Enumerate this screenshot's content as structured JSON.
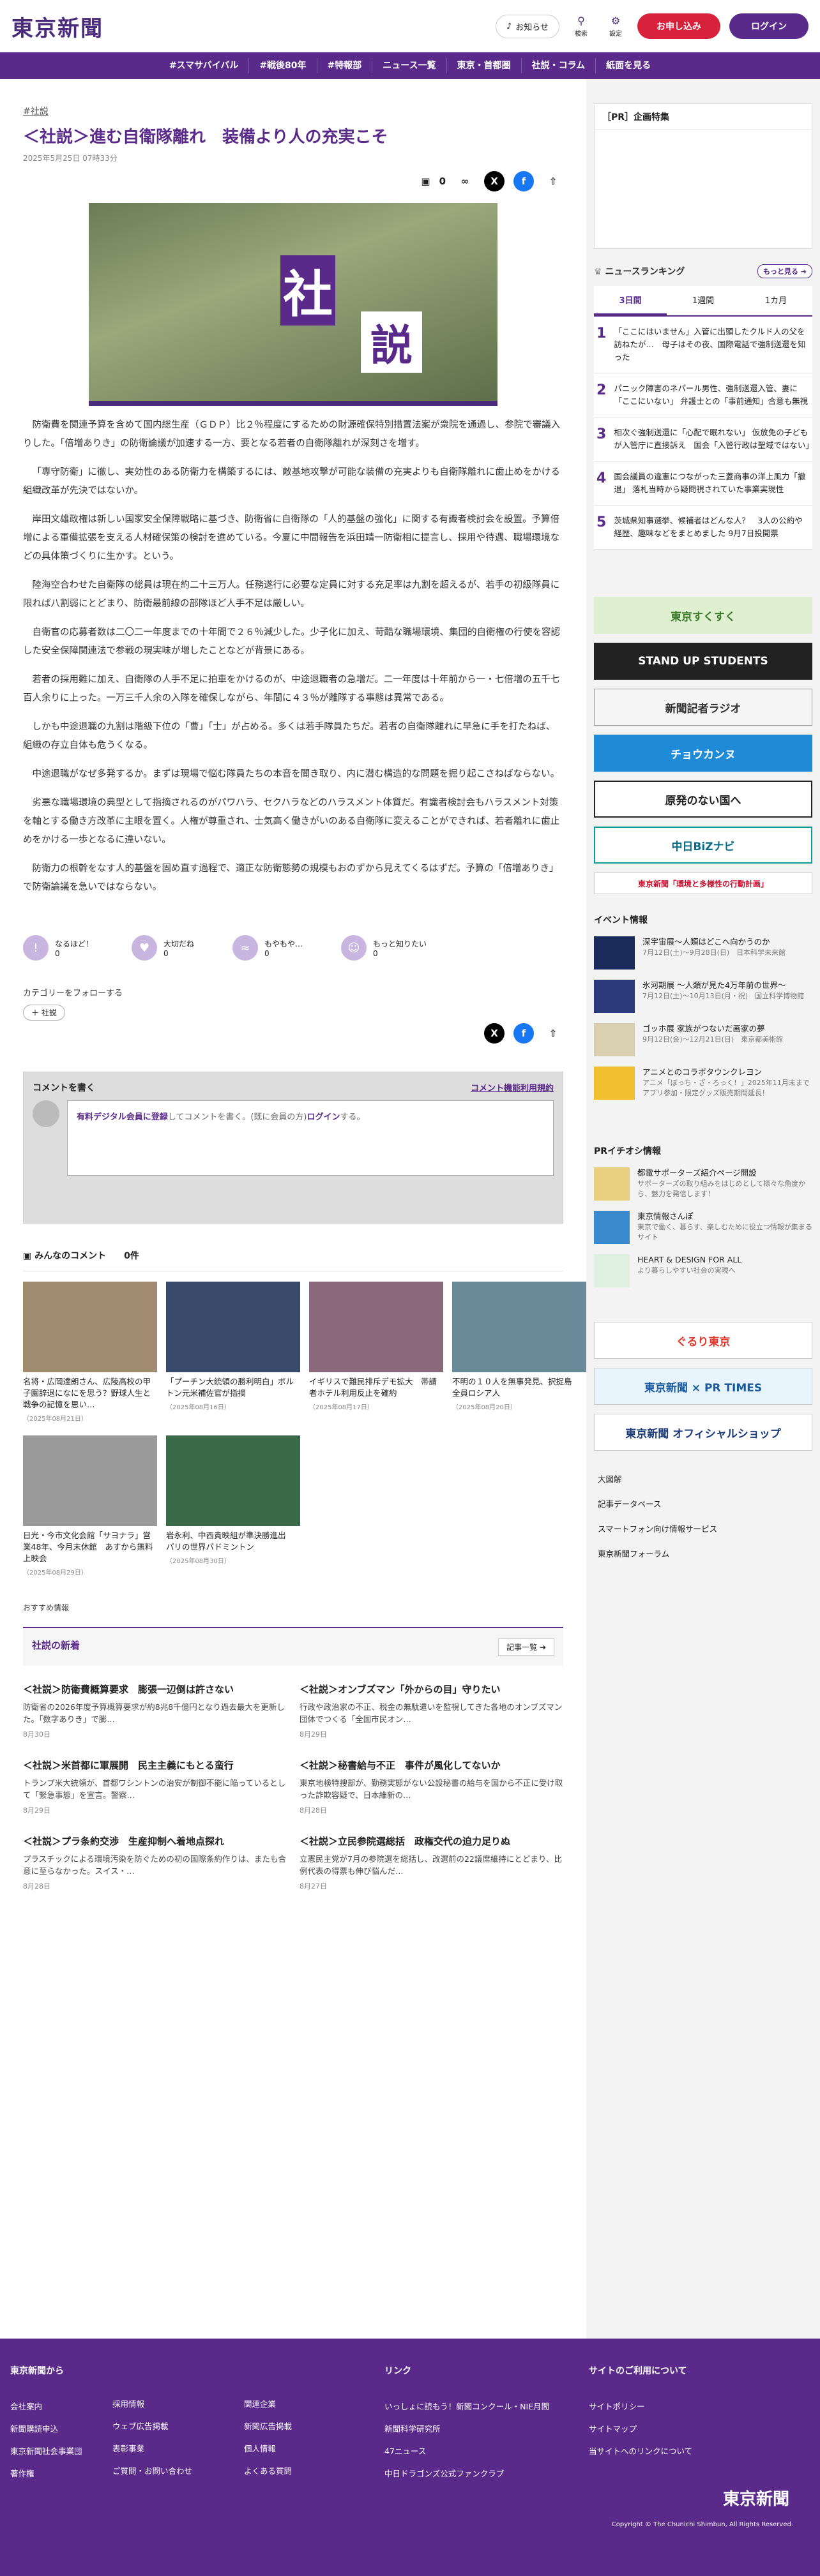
{
  "header": {
    "logo": "東京新聞",
    "notify": "お知らせ",
    "search": "検索",
    "settings": "設定",
    "apply": "お申し込み",
    "login": "ログイン"
  },
  "nav": [
    "#スマサバイバル",
    "#戦後80年",
    "#特報部",
    "ニュース一覧",
    "東京・首都圏",
    "社説・コラム",
    "紙面を見る"
  ],
  "article": {
    "tag": "#社説",
    "title": "＜社説＞進む自衛隊離れ　装備より人の充実こそ",
    "date": "2025年5月25日 07時33分",
    "comment_count": "0",
    "hero_k1": "社",
    "hero_k2": "説",
    "paragraphs": [
      "防衛費を関連予算を含めて国内総生産（ＧＤＰ）比２％程度にするための財源確保特別措置法案が衆院を通過し、参院で審議入りした。「倍増ありき」の防衛論議が加速する一方、要となる若者の自衛隊離れが深刻さを増す。",
      "「専守防衛」に徹し、実効性のある防衛力を構築するには、敵基地攻撃が可能な装備の充実よりも自衛隊離れに歯止めをかける組織改革が先決ではないか。",
      "岸田文雄政権は新しい国家安全保障戦略に基づき、防衛省に自衛隊の「人的基盤の強化」に関する有識者検討会を設置。予算倍増による軍備拡張を支える人材確保策の検討を進めている。今夏に中間報告を浜田靖一防衛相に提言し、採用や待遇、職場環境などの具体策づくりに生かす。という。",
      "陸海空合わせた自衛隊の総員は現在約二十三万人。任務遂行に必要な定員に対する充足率は九割を超えるが、若手の初級隊員に限れば八割弱にとどまり、防衛最前線の部隊ほど人手不足は厳しい。",
      "自衛官の応募者数は二〇二一年度までの十年間で２６％減少した。少子化に加え、苛酷な職場環境、集団的自衛権の行使を容認した安全保障関連法で参戦の現実味が増したことなどが背景にある。",
      "若者の採用難に加え、自衛隊の人手不足に拍車をかけるのが、中途退職者の急増だ。二一年度は十年前から一・七倍増の五千七百人余りに上った。一万三千人余の入隊を確保しながら、年間に４３％が離隊する事態は異常である。",
      "しかも中途退職の九割は階級下位の「曹」「士」が占める。多くは若手隊員たちだ。若者の自衛隊離れに早急に手を打たねば、組織の存立自体も危うくなる。",
      "中途退職がなぜ多発するか。まずは現場で悩む隊員たちの本音を聞き取り、内に潜む構造的な問題を掘り起こさねばならない。",
      "劣悪な職場環境の典型として指摘されるのがパワハラ、セクハラなどのハラスメント体質だ。有識者検討会もハラスメント対策を軸とする働き方改革に主眼を置く。人権が尊重され、士気高く働きがいのある自衛隊に変えることができれば、若者離れに歯止めをかける一歩となるに違いない。",
      "防衛力の根幹をなす人的基盤を固め直す過程で、適正な防衛態勢の規模もおのずから見えてくるはずだ。予算の「倍増ありき」で防衛論議を急いではならない。"
    ]
  },
  "reactions": [
    {
      "label": "なるほど！",
      "count": "0"
    },
    {
      "label": "大切だね",
      "count": "0"
    },
    {
      "label": "もやもや…",
      "count": "0"
    },
    {
      "label": "もっと知りたい",
      "count": "0"
    }
  ],
  "category": {
    "heading": "カテゴリーをフォローする",
    "chip": "＋ 社説"
  },
  "comment_box": {
    "title": "コメントを書く",
    "terms": "コメント機能利用規約",
    "text_pre": "有料デジタル会員に登録",
    "text_mid": "してコメントを書く。(既に会員の方)",
    "text_login": "ログイン",
    "text_post": "する。"
  },
  "comments": {
    "title": "みんなのコメント",
    "count": "0件"
  },
  "related": [
    {
      "title": "名将・広岡達朗さん、広陵高校の甲子園辞退になにを思う？野球人生と戦争の記憶を思い…",
      "date": "（2025年08月21日）"
    },
    {
      "title": "「プーチン大統領の勝利明白」ボルトン元米補佐官が指摘",
      "date": "（2025年08月16日）"
    },
    {
      "title": "イギリスで難民排斥デモ拡大　帯請者ホテル利用反止を確約",
      "date": "（2025年08月17日）"
    },
    {
      "title": "不明の１０人を無事発見、択捉島　全員ロシア人",
      "date": "（2025年08月20日）"
    },
    {
      "title": "日光・今市文化会館「サヨナラ」営業48年、今月末休館　あすから無料上映会",
      "date": "（2025年08月29日）"
    },
    {
      "title": "岩永利、中西貴映組が準決勝進出　パリの世界バドミントン",
      "date": "（2025年08月30日）"
    }
  ],
  "recommend": "おすすめ情報",
  "editorials": {
    "title": "社説の新着",
    "more": "記事一覧 ➔",
    "items": [
      {
        "title": "＜社説＞防衛費概算要求　膨張一辺倒は許さない",
        "excerpt": "防衛省の2026年度予算概算要求が約8兆8千億円となり過去最大を更新した。「数字ありき」で膨…",
        "date": "8月30日"
      },
      {
        "title": "＜社説＞オンブズマン「外からの目」守りたい",
        "excerpt": "行政や政治家の不正、税金の無駄遣いを監視してきた各地のオンブズマン団体でつくる「全国市民オン…",
        "date": "8月29日"
      },
      {
        "title": "＜社説＞米首都に軍展開　民主主義にもとる蛮行",
        "excerpt": "トランプ米大統領が、首都ワシントンの治安が制御不能に陥っているとして「緊急事態」を宣言。警察…",
        "date": "8月29日"
      },
      {
        "title": "＜社説＞秘書給与不正　事件が風化してないか",
        "excerpt": "東京地検特捜部が、勤務実態がない公設秘書の給与を国から不正に受け取った詐欺容疑で、日本維新の…",
        "date": "8月28日"
      },
      {
        "title": "＜社説＞プラ条約交渉　生産抑制へ着地点探れ",
        "excerpt": "プラスチックによる環境汚染を防ぐための初の国際条約作りは、またも合意に至らなかった。スイス・…",
        "date": "8月28日"
      },
      {
        "title": "＜社説＞立民参院選総括　政権交代の迫力足りぬ",
        "excerpt": "立憲民主党が7月の参院選を総括し、改選前の22議席維持にとどまり、比例代表の得票も伸び悩んだ…",
        "date": "8月27日"
      }
    ]
  },
  "sidebar": {
    "pr": "［PR］企画特集",
    "ranking_title": "ニュースランキング",
    "ranking_more": "もっと見る ➔",
    "tabs": [
      "3日間",
      "1週間",
      "1カ月"
    ],
    "ranking": [
      "「ここにはいません」入管に出頭したクルド人の父を訪ねたが…　母子はその夜、国際電話で強制送還を知った",
      "パニック障害のネパール男性、強制送還入管、妻に「ここにいない」 弁護士との「事前通知」合意も無視",
      "相次ぐ強制送還に「心配で眠れない」 仮放免の子どもが入管庁に直接訴え　国会「入管行政は聖域ではない」",
      "国会議員の違憲につながった三菱商事の洋上風力「撤退」 落札当時から疑問視されていた事業実現性",
      "茨城県知事選挙、候補者はどんな人？　3人の公約や経歴、趣味などをまとめました 9月7日投開票"
    ],
    "banners": [
      "東京すくすく",
      "STAND UP STUDENTS",
      "新聞記者ラジオ",
      "チョウカンヌ",
      "原発のない国へ",
      "中日BiZナビ",
      "東京新聞「環境と多様性の行動計画」"
    ],
    "events_title": "イベント情報",
    "events": [
      {
        "t": "深宇宙展～人類はどこへ向かうのか",
        "s": "7月12日(土)～9月28日(日)　日本科学未来館"
      },
      {
        "t": "氷河期展 ～人類が見た4万年前の世界～",
        "s": "7月12日(土)～10月13日(月・祝)　国立科学博物館"
      },
      {
        "t": "ゴッホ展 家族がつないだ画家の夢",
        "s": "9月12日(金)～12月21日(日)　東京都美術館"
      },
      {
        "t": "アニメとのコラボタウンクレヨン",
        "s": "アニメ「ぼっち・ざ・ろっく！」2025年11月末までアプリ参加・限定グッズ販売期間延長！"
      }
    ],
    "pr_title": "PRイチオシ情報",
    "pr_items": [
      {
        "t": "都電サポーターズ紹介ページ開設",
        "s": "サポーターズの取り組みをはじめとして様々な角度から、魅力を発信します！"
      },
      {
        "t": "東京情報さんぽ",
        "s": "東京で働く、暮らす、楽しむために役立つ情報が集まるサイト"
      },
      {
        "t": "HEART & DESIGN FOR ALL",
        "s": "より暮らしやすい社会の実現へ"
      }
    ],
    "shop_banners": [
      "ぐるり東京",
      "東京新聞 × PR TIMES",
      "東京新聞 オフィシャルショップ"
    ],
    "links": [
      "大図解",
      "記事データベース",
      "スマートフォン向け情報サービス",
      "東京新聞フォーラム"
    ]
  },
  "footer": {
    "col1_title": "東京新聞から",
    "col1": [
      "会社案内",
      "新聞購読申込",
      "東京新聞社会事業団",
      "著作権"
    ],
    "col2": [
      "採用情報",
      "ウェブ広告掲載",
      "表彰事業",
      "ご質問・お問い合わせ"
    ],
    "col3": [
      "関連企業",
      "新聞広告掲載",
      "個人情報",
      "よくある質問"
    ],
    "col4_title": "リンク",
    "col4": [
      "いっしょに読もう！新聞コンクール・NIE月間",
      "新聞科学研究所",
      "47ニュース",
      "中日ドラゴンズ公式ファンクラブ"
    ],
    "col5_title": "サイトのご利用について",
    "col5": [
      "サイトポリシー",
      "サイトマップ",
      "当サイトへのリンクについて"
    ],
    "logo": "東京新聞",
    "copyright": "Copyright © The Chunichi Shimbun, All Rights Reserved."
  }
}
